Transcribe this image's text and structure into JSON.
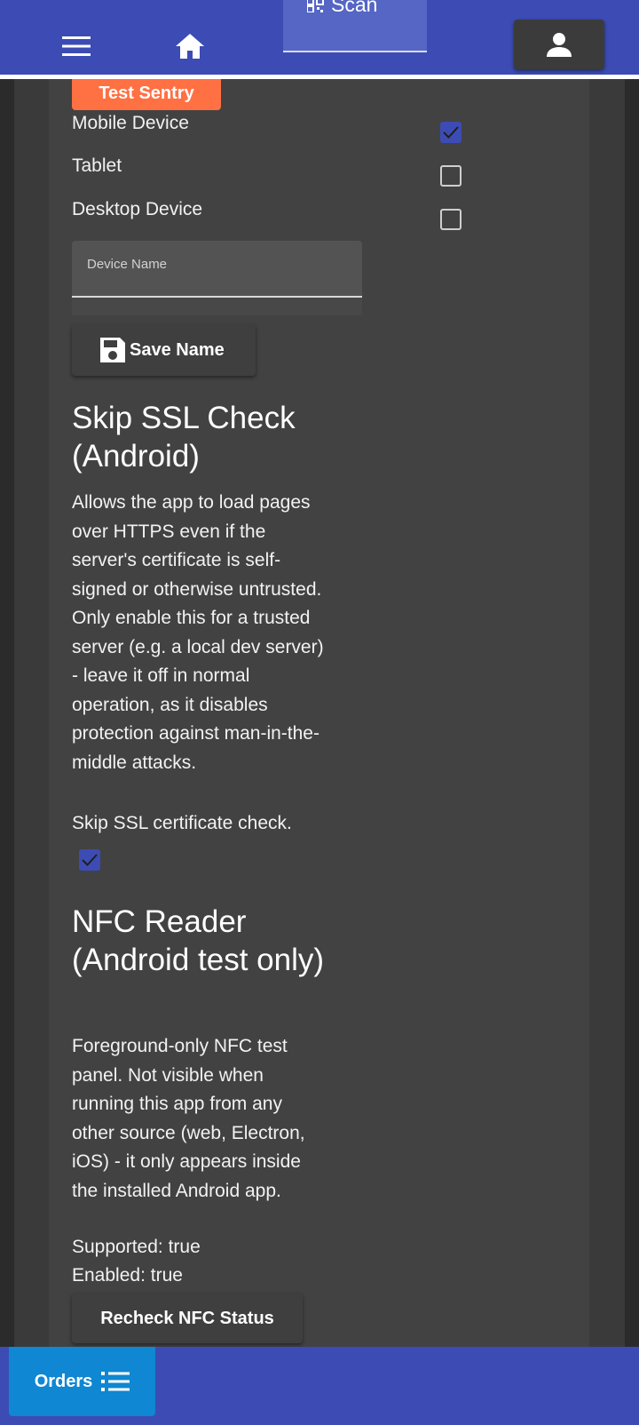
{
  "colors": {
    "primary": "#3c4cb4",
    "accent_orange": "#ff7043",
    "orders_blue": "#0f87d2",
    "panel": "#424242"
  },
  "topbar": {
    "scan_label": "Scan",
    "icons": [
      "menu-icon",
      "home-icon",
      "qr-code-icon",
      "person-icon"
    ]
  },
  "sentry": {
    "button_label": "Test Sentry"
  },
  "device_type": {
    "options": [
      {
        "label": "Mobile Device",
        "checked": true
      },
      {
        "label": "Tablet",
        "checked": false
      },
      {
        "label": "Desktop Device",
        "checked": false
      }
    ]
  },
  "device_name": {
    "label": "Device Name",
    "value": "",
    "save_label": "Save Name",
    "save_icon": "floppy-disk-icon"
  },
  "ssl": {
    "heading": "Skip SSL Check (Android)",
    "description": "Allows the app to load pages over HTTPS even if the server's certificate is self-signed or otherwise untrusted. Only enable this for a trusted server (e.g. a local dev server) - leave it off in normal operation, as it disables protection against man-in-the-middle attacks.",
    "checkbox_label": "Skip SSL certificate check.",
    "checked": true
  },
  "nfc": {
    "heading": "NFC Reader (Android test only)",
    "description": "Foreground-only NFC test panel. Not visible when running this app from any other source (web, Electron, iOS) - it only appears inside the installed Android app.",
    "supported": "Supported: true",
    "enabled": "Enabled: true",
    "recheck_label": "Recheck NFC Status"
  },
  "bottombar": {
    "orders_label": "Orders",
    "orders_icon": "list-icon"
  }
}
